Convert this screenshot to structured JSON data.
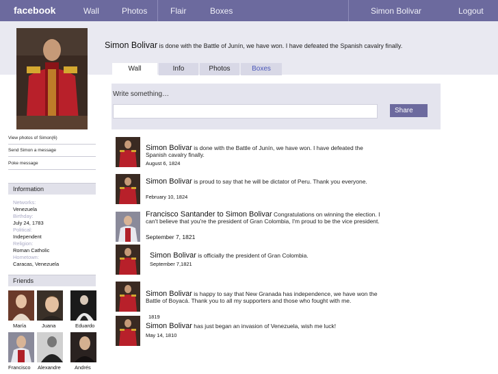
{
  "topbar": {
    "logo": "facebook",
    "nav": [
      "Wall",
      "Photos",
      "Flair",
      "Boxes"
    ],
    "user": "Simon Bolivar",
    "logout": "Logout"
  },
  "profile": {
    "name": "Simon Bolivar",
    "status": "is done with the Battle of Junín, we have won. I have defeated the Spanish cavalry finally."
  },
  "tabs": [
    "Wall",
    "Info",
    "Photos",
    "Boxes"
  ],
  "publisher": {
    "prompt": "Write something…",
    "share_label": "Share"
  },
  "sidebar": {
    "links": [
      "View photos of Simon(6)",
      "Send Simon a message",
      "Poke message"
    ],
    "information_header": "Information",
    "info": [
      {
        "label": "Networks:",
        "value": "Venezuela"
      },
      {
        "label": "Birthday:",
        "value": "July 24, 1783"
      },
      {
        "label": "Political:",
        "value": "Independent"
      },
      {
        "label": "Religion:",
        "value": "Roman Catholic"
      },
      {
        "label": "Hometown:",
        "value": "Caracas, Venezuela"
      }
    ],
    "friends_header": "Friends",
    "friends": [
      "María",
      "Juana",
      "Eduardo",
      "Francisco",
      "Alexandre",
      "Andrés"
    ]
  },
  "posts": [
    {
      "author": "Simon Bolivar",
      "text": "is done with the Battle of Junín, we have won. I have defeated the Spanish cavalry finally.",
      "date": "August 6, 1824"
    },
    {
      "author": "Simon Bolivar",
      "text": "is proud to say that he will be dictator of Peru. Thank you everyone.",
      "date": "February 10, 1824"
    },
    {
      "author": "Francisco Santander to Simon Bolivar",
      "text": "Congratulations on winning the election. I can't believe that you're the president of Gran Colombia, I'm proud to be the vice president.",
      "date": "September 7, 1821"
    },
    {
      "author": "Simon Bolivar",
      "text": "is officially the president of Gran Colombia.",
      "date": "September 7,1821"
    },
    {
      "author": "Simon Bolivar",
      "text": "is happy to say that New Granada has independence, we have won the Battle of Boyacá. Thank you to all my supporters and those who fought with me.",
      "date": "1819"
    },
    {
      "author": "Simon Bolivar",
      "text": "has just began an invasion of Venezuela, wish me luck!",
      "date": "May 14, 1810"
    }
  ]
}
